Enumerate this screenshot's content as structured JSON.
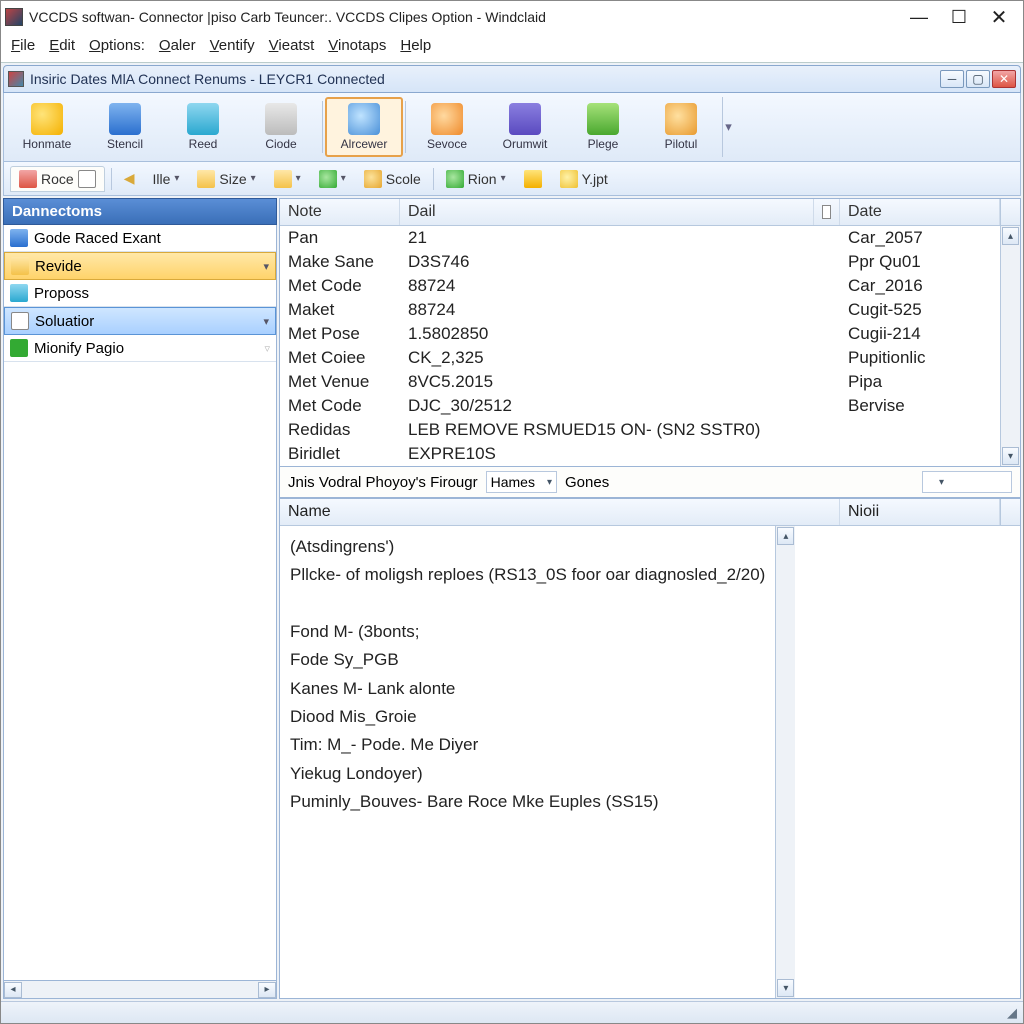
{
  "outer_window": {
    "title": "VCCDS softwan- Connector |piso Carb Teuncer:. VCCDS Clipes Option - Windclaid"
  },
  "menu": [
    "File",
    "Edit",
    "Options:",
    "Oaler",
    "Ventify",
    "Vieatst",
    "Vinotaps",
    "Help"
  ],
  "child_window": {
    "title": "Insiric Dates MlA Connect Renums - LEYCR1 Connected"
  },
  "toolbar": {
    "items": [
      "Honmate",
      "Stencil",
      "Reed",
      "Ciode",
      "Alrcewer",
      "Sevoce",
      "Orumwit",
      "Plege",
      "Pilotul"
    ],
    "active_index": 4
  },
  "toolbar2": {
    "tab": "Roce",
    "items": [
      "Ille",
      "Size",
      "",
      "",
      "Scole",
      "Rion",
      "",
      "Y.jpt"
    ]
  },
  "sidebar": {
    "header": "Dannectoms",
    "items": [
      {
        "label": "Gode Raced Exant",
        "style": ""
      },
      {
        "label": "Revide",
        "style": "sel-orange",
        "arrow": "▾"
      },
      {
        "label": "Proposs",
        "style": ""
      },
      {
        "label": "Soluatior",
        "style": "sel-blue",
        "arrow": "▾"
      },
      {
        "label": "Mionify Pagio",
        "style": "",
        "arrow": "▿"
      }
    ]
  },
  "upper_grid": {
    "headers": [
      "Note",
      "Dail",
      "Date"
    ],
    "rows": [
      {
        "note": "Pan",
        "dail": "21",
        "date": "Car_2057"
      },
      {
        "note": "Make Sane",
        "dail": "D3S746",
        "date": "Ppr Qu01"
      },
      {
        "note": "Met Code",
        "dail": "88724",
        "date": "Car_2016"
      },
      {
        "note": "Maket",
        "dail": "88724",
        "date": "Cugit-525"
      },
      {
        "note": "Met Pose",
        "dail": "1.5802850",
        "date": "Cugii-214"
      },
      {
        "note": "Met Coiee",
        "dail": "CK_2,325",
        "date": "Pupitionlic"
      },
      {
        "note": "Met Venue",
        "dail": "8VC5.2015",
        "date": "Pipa"
      },
      {
        "note": "Met Code",
        "dail": "DJC_30/2512",
        "date": "Bervise"
      },
      {
        "note": "Redidas",
        "dail": "LEB REMOVE RSMUED15 ON- (SN2 SSTR0)",
        "date": ""
      },
      {
        "note": "Biridlet",
        "dail": "EXPRE10S",
        "date": ""
      }
    ]
  },
  "filterbar": {
    "label": "Jnis Vodral Phoyoy's Firougr",
    "combo1": "Hames",
    "text": "Gones",
    "combo2": ""
  },
  "lower_grid": {
    "headers": [
      "Name",
      "Nioii"
    ],
    "lines": [
      "(Atsdingrens')",
      "Pllcke- of moligsh reploes (RS13_0S foor oar diagnosled_2/20)",
      "",
      "Fond M- (3bonts;",
      "Fode Sy_PGB",
      "Kanes M- Lank alonte",
      "Diood Mis_Groie",
      "Tim: M_- Pode. Me Diyer",
      "Yiekug Londoyer)",
      "Puminly_Bouves- Bare Roce Mke Euples (SS15)"
    ]
  }
}
